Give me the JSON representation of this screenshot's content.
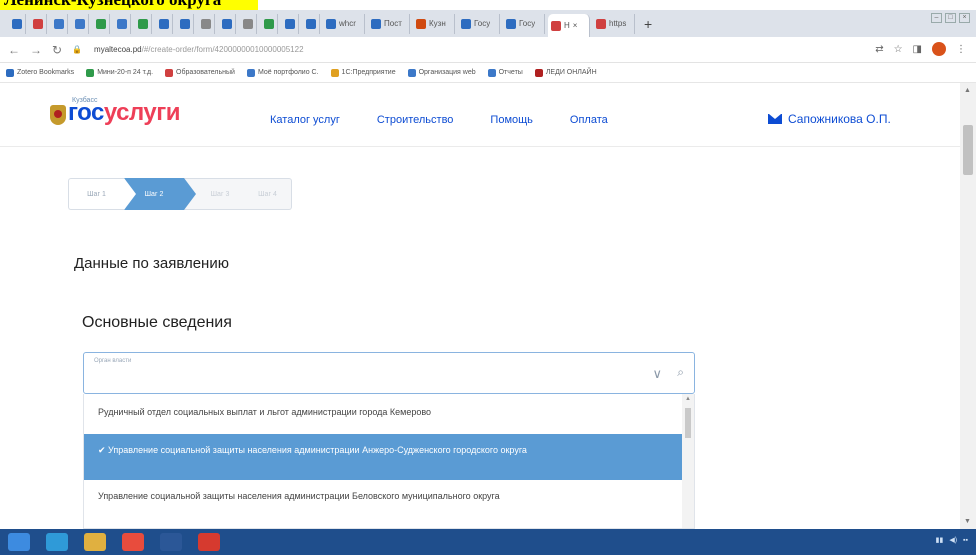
{
  "caption": "Ленинск-Кузнецкого округа",
  "browser": {
    "tabs": [
      {
        "color": "#2d6cc0"
      },
      {
        "color": "#d04040"
      },
      {
        "color": "#3c78c8"
      },
      {
        "color": "#3c78c8"
      },
      {
        "color": "#2f9a4a"
      },
      {
        "color": "#3c78c8"
      },
      {
        "color": "#2f9a4a"
      },
      {
        "color": "#2d6cc0"
      },
      {
        "color": "#2d6cc0"
      },
      {
        "color": "#888888"
      },
      {
        "color": "#2d6cc0"
      },
      {
        "color": "#888888"
      },
      {
        "color": "#2f9a4a"
      },
      {
        "color": "#2d6cc0"
      },
      {
        "color": "#2d6cc0"
      }
    ],
    "wide_tabs": [
      {
        "label": "whcr",
        "color": "#2d6cc0"
      },
      {
        "label": "Пост",
        "color": "#2d6cc0"
      },
      {
        "label": "Кузн",
        "color": "#d04a10"
      },
      {
        "label": "Госу",
        "color": "#2d6cc0"
      },
      {
        "label": "Госу",
        "color": "#2d6cc0"
      }
    ],
    "active_tab_label": "Н",
    "extra_tab_label": "https",
    "url_host": "myaltecoa.pd",
    "url_path": "/#/create-order/form/42000000010000005122",
    "bookmarks": [
      {
        "label": "Zotero Bookmarks",
        "color": "#2d6cc0"
      },
      {
        "label": "Мини-20-п 24 т.д.",
        "color": "#2f9a4a"
      },
      {
        "label": "Образовательный",
        "color": "#d04040"
      },
      {
        "label": "Моё портфолио С.",
        "color": "#3c78c8"
      },
      {
        "label": "1С:Предприятие",
        "color": "#e0a020"
      },
      {
        "label": "Организация web",
        "color": "#3c78c8"
      },
      {
        "label": "Отчеты",
        "color": "#3c78c8"
      },
      {
        "label": "ЛЕДИ ОНЛАЙН",
        "color": "#b02020"
      }
    ]
  },
  "site": {
    "logo_small": "Кузбасс",
    "logo_part1": "гос",
    "logo_part2": "услуги",
    "nav": [
      "Каталог услуг",
      "Строительство",
      "Помощь",
      "Оплата"
    ],
    "user_name": "Сапожникова О.П."
  },
  "stepper": {
    "steps": [
      "Шаг 1",
      "Шаг 2",
      "Шаг 3",
      "Шаг 4"
    ],
    "active_index": 1
  },
  "form": {
    "heading_data": "Данные по заявлению",
    "heading_main": "Основные сведения",
    "combo_label": "Орган власти",
    "options": [
      "Рудничный отдел социальных выплат и льгот администрации города Кемерово",
      "✔ Управление социальной защиты населения администрации Анжеро-Судженского городского округа",
      "Управление социальной защиты населения администрации Беловского муниципального округа"
    ],
    "selected_index": 1
  },
  "taskbar": {
    "icons": [
      {
        "name": "start-icon",
        "color": "#3d8be0"
      },
      {
        "name": "ie-icon",
        "color": "#2f9ad8"
      },
      {
        "name": "explorer-icon",
        "color": "#e0b040"
      },
      {
        "name": "chrome-icon",
        "color": "#e84c3d"
      },
      {
        "name": "word-icon",
        "color": "#2b5797"
      },
      {
        "name": "pdf-icon",
        "color": "#d63a2f"
      }
    ]
  }
}
